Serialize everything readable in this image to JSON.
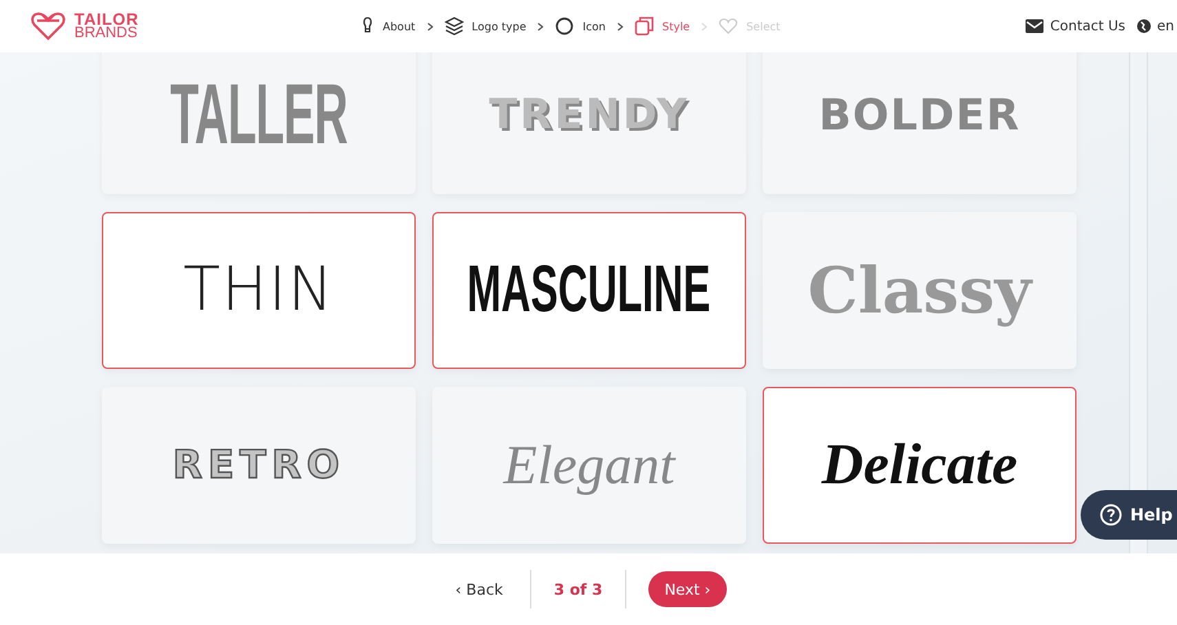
{
  "brand": {
    "line_1": "TAILOR",
    "line_2": "BRANDS"
  },
  "steps": [
    {
      "label": "About",
      "selected": false,
      "disabled": false,
      "kind": "bulb"
    },
    {
      "label": "Logo type",
      "selected": false,
      "disabled": false,
      "kind": "layers"
    },
    {
      "label": "Icon",
      "selected": false,
      "disabled": false,
      "kind": "circle"
    },
    {
      "label": "Style",
      "selected": true,
      "disabled": false,
      "kind": "squares"
    },
    {
      "label": "Select",
      "selected": false,
      "disabled": true,
      "kind": "heart"
    }
  ],
  "contact": "Contact Us",
  "language": "en",
  "styles": [
    {
      "label": "TALLER",
      "kind": "tall",
      "selected": false
    },
    {
      "label": "TRENDY",
      "kind": "trendy",
      "selected": false
    },
    {
      "label": "BOLDER",
      "kind": "bold",
      "selected": false
    },
    {
      "label": "THIN",
      "kind": "thin",
      "selected": true
    },
    {
      "label": "MASCULINE",
      "kind": "masculine",
      "selected": true
    },
    {
      "label": "Classy",
      "kind": "classy",
      "selected": false
    },
    {
      "label": "RETRO",
      "kind": "retro",
      "selected": false
    },
    {
      "label": "Elegant",
      "kind": "elegant",
      "selected": false
    },
    {
      "label": "Delicate",
      "kind": "delicate",
      "selected": true
    }
  ],
  "help": "Help",
  "footer": {
    "back": "‹ Back",
    "progress": "3 of 3",
    "next": "Next ›"
  }
}
